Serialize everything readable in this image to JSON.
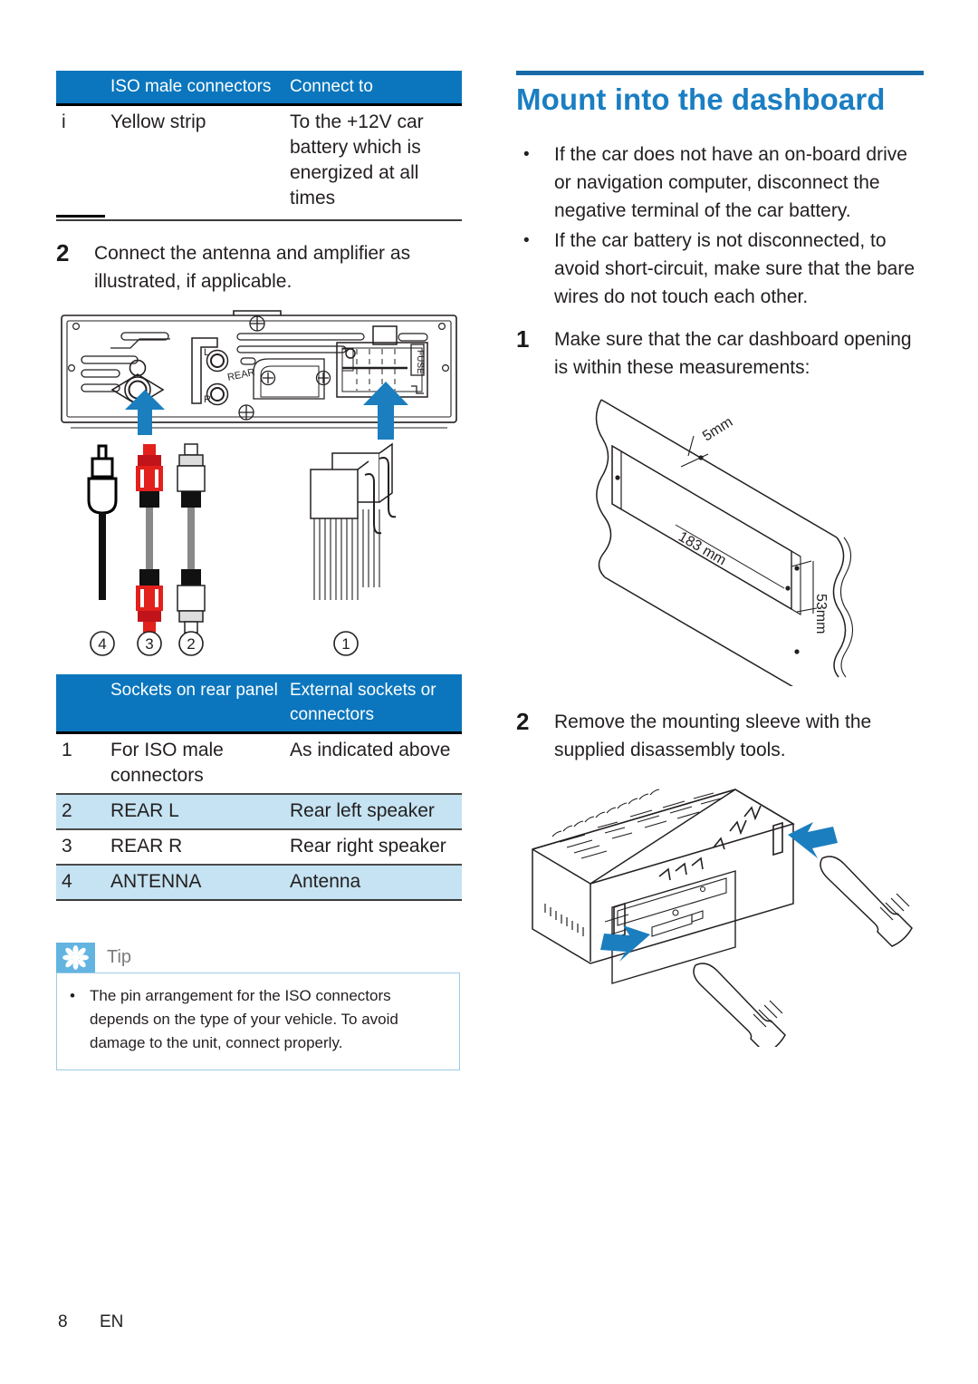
{
  "page": {
    "footer_page_number": "8",
    "footer_language": "EN"
  },
  "colors": {
    "table_header_blue": "#0b76bd",
    "row_shade_blue": "#c5e3f2",
    "heading_blue": "#1a7ec2",
    "heading_rule_blue": "#1769a8",
    "tip_icon_blue": "#63b4e0",
    "tip_border_blue": "#9ecbe6",
    "arrow_blue": "#1b7ebe",
    "connector_red": "#e2201c"
  },
  "left_column": {
    "iso_table": {
      "headers": [
        "",
        "ISO male connectors",
        "Connect to"
      ],
      "rows": [
        {
          "marker": "i",
          "name": "Yellow strip",
          "connect_to": "To the +12V car battery which is energized at all times"
        }
      ]
    },
    "step2": {
      "number": "2",
      "text": "Connect the antenna and amplifier as illustrated, if applicable."
    },
    "rear_panel_figure": {
      "labels": {
        "rear_left": "L",
        "rear_group": "REAR",
        "rear_right": "R",
        "fuse": "FUSE"
      },
      "callouts": [
        "4",
        "3",
        "2",
        "1"
      ]
    },
    "sockets_table": {
      "headers": [
        "",
        "Sockets on rear panel",
        "External sockets or connectors"
      ],
      "rows": [
        {
          "num": "1",
          "socket": "For ISO male connectors",
          "external": "As indicated above",
          "shaded": false,
          "bold": false
        },
        {
          "num": "2",
          "socket": "REAR L",
          "external": "Rear left speaker",
          "shaded": true,
          "bold": true
        },
        {
          "num": "3",
          "socket": "REAR R",
          "external": "Rear right speaker",
          "shaded": false,
          "bold": true
        },
        {
          "num": "4",
          "socket": "ANTENNA",
          "external": "Antenna",
          "shaded": true,
          "bold": true
        }
      ]
    },
    "tip": {
      "label": "Tip",
      "icon": "asterisk-icon",
      "bullet": "•",
      "text": "The pin arrangement for the ISO connectors depends on the type of your vehicle. To avoid damage to the unit, connect properly."
    }
  },
  "right_column": {
    "heading": "Mount into the dashboard",
    "bullets": [
      {
        "marker": "•",
        "text": "If the car does not have an on-board drive or navigation computer, disconnect the negative terminal of the car battery."
      },
      {
        "marker": "•",
        "text": "If the car battery is not disconnected, to avoid short-circuit, make sure that the bare wires do not touch each other."
      }
    ],
    "step1": {
      "number": "1",
      "text": "Make sure that the car dashboard opening is within these measurements:"
    },
    "dashboard_figure": {
      "dimensions": {
        "thickness": "5mm",
        "width": "183 mm",
        "height": "53mm"
      }
    },
    "step2": {
      "number": "2",
      "text": "Remove the mounting sleeve with the supplied disassembly tools."
    }
  }
}
